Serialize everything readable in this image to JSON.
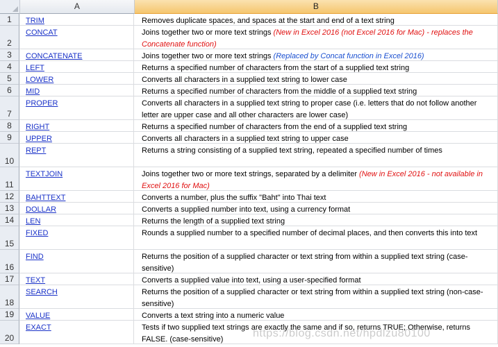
{
  "columns": [
    "A",
    "B"
  ],
  "rows": [
    {
      "num": "1",
      "func": "TRIM",
      "desc": "Removes duplicate spaces, and spaces at the start and end of a text string",
      "note": "",
      "note_color": ""
    },
    {
      "num": "2",
      "func": "CONCAT",
      "desc": "Joins together two or more text strings",
      "note": "(New in Excel 2016 (not Excel 2016 for Mac) - replaces the Concatenate function)",
      "note_color": "red"
    },
    {
      "num": "3",
      "func": "CONCATENATE",
      "desc": "Joins together two or more text strings",
      "note": "(Replaced by Concat function in Excel 2016)",
      "note_color": "blue"
    },
    {
      "num": "4",
      "func": "LEFT",
      "desc": "Returns a specified number of characters from the start of a supplied text string",
      "note": "",
      "note_color": ""
    },
    {
      "num": "5",
      "func": "LOWER",
      "desc": "Converts all characters in a supplied text string to lower case",
      "note": "",
      "note_color": ""
    },
    {
      "num": "6",
      "func": "MID",
      "desc": "Returns a specified number of characters from the middle of a supplied text string",
      "note": "",
      "note_color": ""
    },
    {
      "num": "7",
      "func": "PROPER",
      "desc": "Converts all characters in a supplied text string to proper case (i.e. letters that do not follow another letter are upper case and all other characters are lower case)",
      "note": "",
      "note_color": ""
    },
    {
      "num": "8",
      "func": "RIGHT",
      "desc": "Returns a specified number of characters from the end of a supplied text string",
      "note": "",
      "note_color": ""
    },
    {
      "num": "9",
      "func": "UPPER",
      "desc": "Converts all characters in a supplied text string to upper case",
      "note": "",
      "note_color": ""
    },
    {
      "num": "10",
      "func": "REPT",
      "desc": "Returns a string consisting of a supplied text string, repeated a specified number of times",
      "note": "",
      "note_color": ""
    },
    {
      "num": "11",
      "func": "TEXTJOIN",
      "desc": "Joins together two or more text strings, separated by a delimiter",
      "note": "(New in Excel 2016 - not available in Excel 2016 for Mac)",
      "note_color": "red"
    },
    {
      "num": "12",
      "func": "BAHTTEXT",
      "desc": "Converts a number, plus the suffix \"Baht\" into Thai text",
      "note": "",
      "note_color": ""
    },
    {
      "num": "13",
      "func": "DOLLAR",
      "desc": "Converts a supplied number into text, using a currency format",
      "note": "",
      "note_color": ""
    },
    {
      "num": "14",
      "func": "LEN",
      "desc": "Returns the length of a supplied text string",
      "note": "",
      "note_color": ""
    },
    {
      "num": "15",
      "func": "FIXED",
      "desc": "Rounds a supplied number to a specified number of decimal places, and then converts this into text",
      "note": "",
      "note_color": ""
    },
    {
      "num": "16",
      "func": "FIND",
      "desc": "Returns the position of a supplied character or text string from within a supplied text string (case-sensitive)",
      "note": "",
      "note_color": ""
    },
    {
      "num": "17",
      "func": "TEXT",
      "desc": "Converts a supplied value into text, using a user-specified format",
      "note": "",
      "note_color": ""
    },
    {
      "num": "18",
      "func": "SEARCH",
      "desc": "Returns the position of a supplied character or text string from within a supplied text string (non-case-sensitive)",
      "note": "",
      "note_color": ""
    },
    {
      "num": "19",
      "func": "VALUE",
      "desc": "Converts a text string into a numeric value",
      "note": "",
      "note_color": ""
    },
    {
      "num": "20",
      "func": "EXACT",
      "desc": "Tests if two supplied text strings are exactly the same and if so, returns TRUE; Otherwise, returns FALSE. (case-sensitive)",
      "note": "",
      "note_color": ""
    }
  ],
  "watermark": "https://blog.csdn.net/hpdlzu80100"
}
